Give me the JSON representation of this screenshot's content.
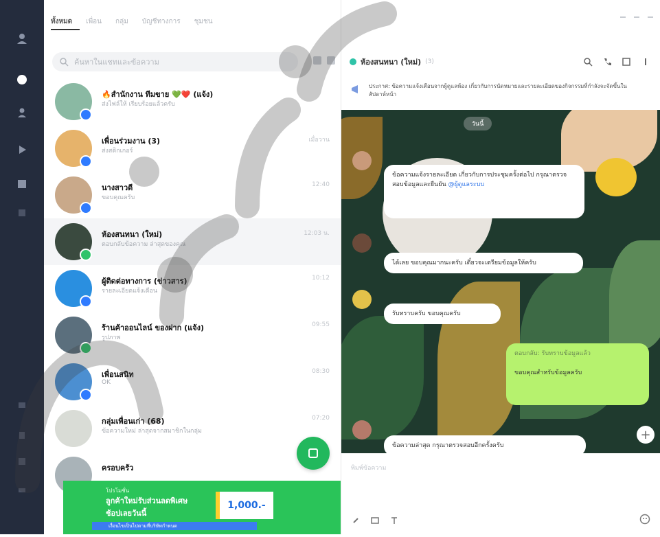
{
  "app": {
    "tabs": [
      "ทั้งหมด",
      "เพื่อน",
      "กลุ่ม",
      "บัญชีทางการ",
      "ชุมชน",
      "ทั้งหมด"
    ],
    "search_placeholder": "ค้นหาในแชทและข้อความ",
    "chats": [
      {
        "name": "🔥สำนักงาน ทีมขาย 💚❤️ (แจ้ง)",
        "preview": "ส่งไฟล์ให้ เรียบร้อยแล้วครับ",
        "time": "",
        "avatar_color": "#8ab9a3",
        "badge": "#2f7bff",
        "selected": false
      },
      {
        "name": "เพื่อนร่วมงาน (3)",
        "preview": "ส่งสติกเกอร์",
        "time": "เมื่อวาน",
        "avatar_color": "#e6b36b",
        "badge": "#2f7bff",
        "selected": false
      },
      {
        "name": "นางสาวดี",
        "preview": "ขอบคุณครับ",
        "time": "12:40",
        "avatar_color": "#c9a98a",
        "badge": "#2f7bff",
        "selected": false
      },
      {
        "name": "ห้องสนทนา (ใหม่)",
        "preview": "ตอบกลับข้อความ ล่าสุดของคุณ",
        "time": "12:03 น.",
        "avatar_color": "#3a4a3f",
        "badge": "#2fc36a",
        "selected": true
      },
      {
        "name": "ผู้ติดต่อทางการ (ข่าวสาร)",
        "preview": "รายละเอียดแจ้งเตือน",
        "time": "10:12",
        "avatar_color": "#2a8fe0",
        "badge": "#2f7bff",
        "selected": false
      },
      {
        "name": "ร้านค้าออนไลน์ ของฝาก (แจ้ง)",
        "preview": "รูปภาพ",
        "time": "09:55",
        "avatar_color": "#5b6f7d",
        "badge": "#2fc36a",
        "selected": false
      },
      {
        "name": "เพื่อนสนิท",
        "preview": "OK",
        "time": "08:30",
        "avatar_color": "#4c8fd1",
        "badge": "#2f7bff",
        "selected": false
      },
      {
        "name": "กลุ่มเพื่อนเก่า (68)",
        "preview": "ข้อความใหม่ ล่าสุดจากสมาชิกในกลุ่ม",
        "time": "07:20",
        "avatar_color": "#d9dcd6",
        "badge": "",
        "selected": false
      },
      {
        "name": "ครอบครัว",
        "preview": "",
        "time": "",
        "avatar_color": "#a9b3b8",
        "badge": "",
        "selected": false
      }
    ],
    "banner": {
      "line1": "โปรโมชั่น",
      "line2": "ลูกค้าใหม่รับส่วนลดพิเศษ",
      "line3": "ช้อปเลยวันนี้",
      "price": "1,000.-",
      "bar": "เงื่อนไขเป็นไปตามที่บริษัทกำหนด"
    },
    "room": {
      "name": "ห้องสนทนา (ใหม่)",
      "count": "(3)",
      "announcement": "ประกาศ: ข้อความแจ้งเตือนจากผู้ดูแลห้อง เกี่ยวกับการนัดหมายและรายละเอียดของกิจกรรมที่กำลังจะจัดขึ้นในสัปดาห์หน้า",
      "date": "วันนี้",
      "messages": [
        {
          "text": "ข้อความแจ้งรายละเอียด เกี่ยวกับการประชุมครั้งต่อไป กรุณาตรวจสอบข้อมูลและยืนยัน",
          "link": "@ผู้ดูแลระบบ",
          "mine": false
        },
        {
          "text": "ได้เลย ขอบคุณมากนะครับ เดี๋ยวจะเตรียมข้อมูลให้ครับ",
          "link": "",
          "mine": false
        },
        {
          "text": "รับทราบครับ ขอบคุณครับ",
          "link": "",
          "mine": false
        },
        {
          "text": "ตอบกลับ: รับทราบข้อมูลแล้ว",
          "sub": "ขอบคุณสำหรับข้อมูลครับ",
          "link": "",
          "mine": true
        },
        {
          "text": "ข้อความล่าสุด กรุณาตรวจสอบอีกครั้งครับ",
          "link": "",
          "mine": false
        }
      ]
    },
    "input_placeholder": "พิมพ์ข้อความ"
  }
}
